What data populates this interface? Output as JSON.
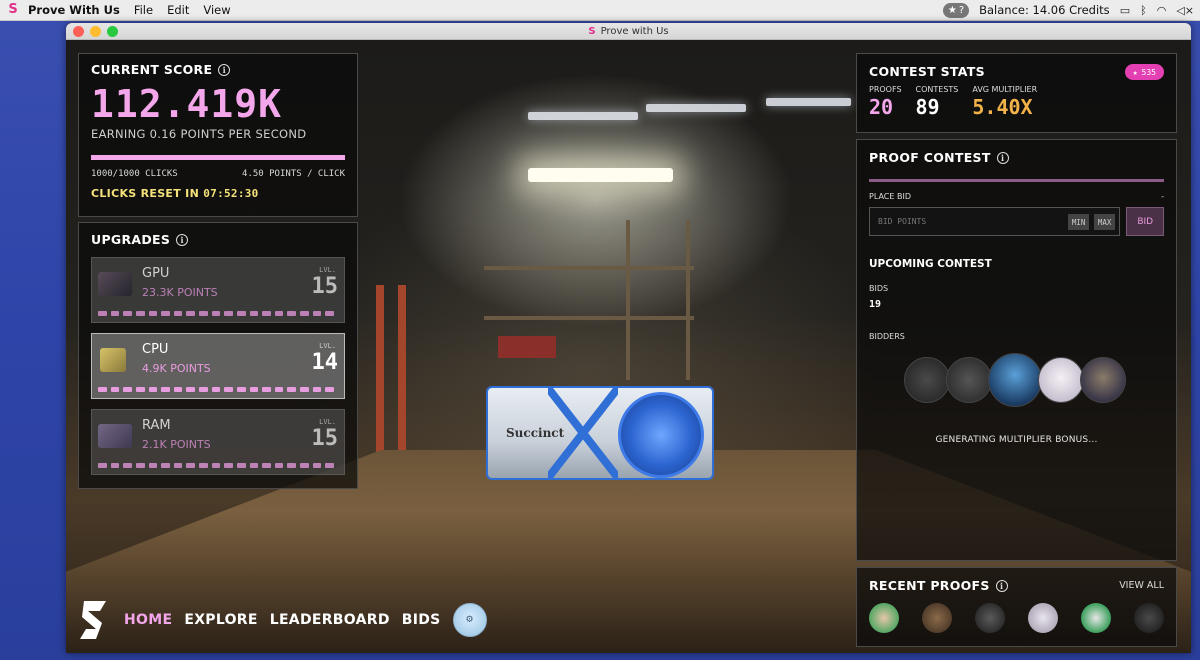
{
  "menubar": {
    "app_name": "Prove With Us",
    "menus": [
      "File",
      "Edit",
      "View"
    ],
    "pill_label": "?",
    "balance": "Balance:  14.06 Credits"
  },
  "window": {
    "title": "Prove with Us"
  },
  "score": {
    "title": "CURRENT SCORE",
    "value": "112.419K",
    "earning": "EARNING 0.16 POINTS PER SECOND",
    "progress_fraction": 1.0,
    "clicks": "1000/1000 CLICKS",
    "points_per_click": "4.50 POINTS / CLICK",
    "reset_label": "CLICKS RESET IN",
    "reset_timer": "07:52:30"
  },
  "upgrades": {
    "title": "UPGRADES",
    "items": [
      {
        "name": "GPU",
        "points": "23.3K POINTS",
        "level_label": "LVL.",
        "level": "15"
      },
      {
        "name": "CPU",
        "points": "4.9K POINTS",
        "level_label": "LVL.",
        "level": "14"
      },
      {
        "name": "RAM",
        "points": "2.1K POINTS",
        "level_label": "LVL.",
        "level": "15"
      }
    ]
  },
  "contest_stats": {
    "title": "CONTEST STATS",
    "badge": "535",
    "proofs_label": "PROOFS",
    "proofs": "20",
    "contests_label": "CONTESTS",
    "contests": "89",
    "multiplier_label": "AVG MULTIPLIER",
    "multiplier": "5.40X",
    "colors": {
      "proofs": "#f3a6ea",
      "contests": "#ffffff",
      "multiplier": "#f2b24a"
    }
  },
  "proof_contest": {
    "title": "PROOF CONTEST",
    "place_bid": "PLACE BID",
    "place_bid_value": "-",
    "bid_placeholder": "BID POINTS",
    "min": "MIN",
    "max": "MAX",
    "bid_button": "BID",
    "upcoming": "UPCOMING CONTEST",
    "bids_label": "BIDS",
    "bids": "19",
    "bidders_label": "BIDDERS",
    "generating": "GENERATING MULTIPLIER BONUS..."
  },
  "recent_proofs": {
    "title": "RECENT PROOFS",
    "view_all": "VIEW ALL"
  },
  "nav": {
    "items": [
      "HOME",
      "EXPLORE",
      "LEADERBOARD",
      "BIDS"
    ]
  },
  "gpu_brand": "Succinct"
}
